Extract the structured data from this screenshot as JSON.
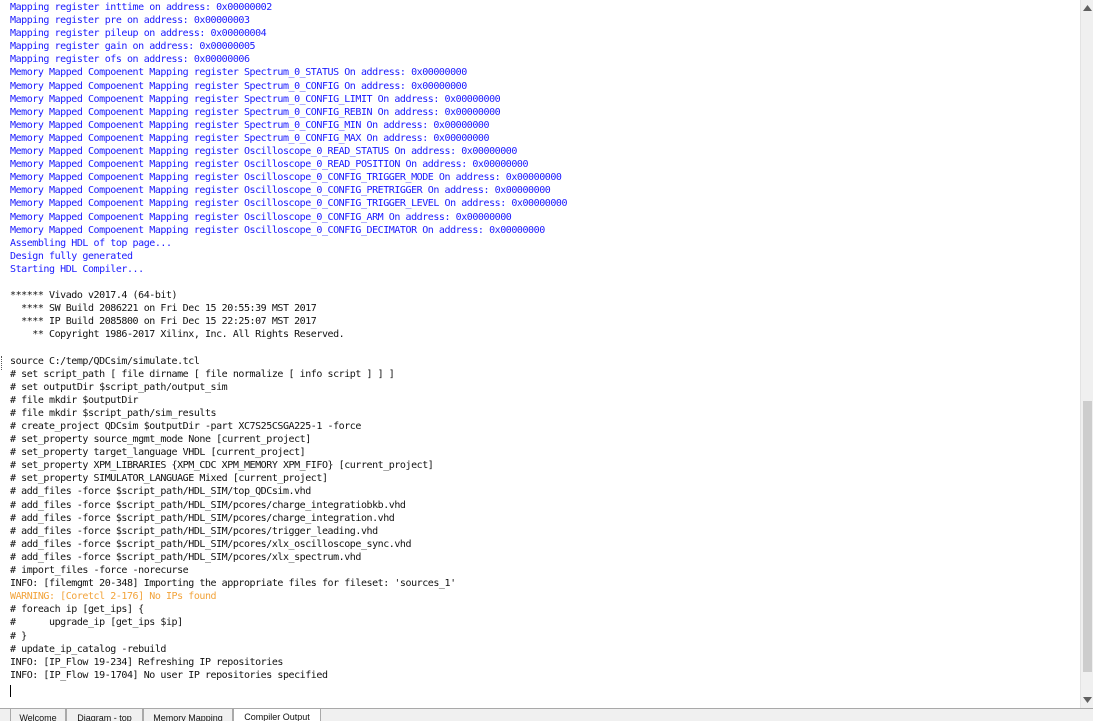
{
  "console": {
    "lines": [
      {
        "text": "Mapping register inttime on address: 0x00000002",
        "style": "blue"
      },
      {
        "text": "Mapping register pre on address: 0x00000003",
        "style": "blue"
      },
      {
        "text": "Mapping register pileup on address: 0x00000004",
        "style": "blue"
      },
      {
        "text": "Mapping register gain on address: 0x00000005",
        "style": "blue"
      },
      {
        "text": "Mapping register ofs on address: 0x00000006",
        "style": "blue"
      },
      {
        "text": "Memory Mapped Compoenent Mapping register Spectrum_0_STATUS On address: 0x00000000",
        "style": "blue"
      },
      {
        "text": "Memory Mapped Compoenent Mapping register Spectrum_0_CONFIG On address: 0x00000000",
        "style": "blue"
      },
      {
        "text": "Memory Mapped Compoenent Mapping register Spectrum_0_CONFIG_LIMIT On address: 0x00000000",
        "style": "blue"
      },
      {
        "text": "Memory Mapped Compoenent Mapping register Spectrum_0_CONFIG_REBIN On address: 0x00000000",
        "style": "blue"
      },
      {
        "text": "Memory Mapped Compoenent Mapping register Spectrum_0_CONFIG_MIN On address: 0x00000000",
        "style": "blue"
      },
      {
        "text": "Memory Mapped Compoenent Mapping register Spectrum_0_CONFIG_MAX On address: 0x00000000",
        "style": "blue"
      },
      {
        "text": "Memory Mapped Compoenent Mapping register Oscilloscope_0_READ_STATUS On address: 0x00000000",
        "style": "blue"
      },
      {
        "text": "Memory Mapped Compoenent Mapping register Oscilloscope_0_READ_POSITION On address: 0x00000000",
        "style": "blue"
      },
      {
        "text": "Memory Mapped Compoenent Mapping register Oscilloscope_0_CONFIG_TRIGGER_MODE On address: 0x00000000",
        "style": "blue"
      },
      {
        "text": "Memory Mapped Compoenent Mapping register Oscilloscope_0_CONFIG_PRETRIGGER On address: 0x00000000",
        "style": "blue"
      },
      {
        "text": "Memory Mapped Compoenent Mapping register Oscilloscope_0_CONFIG_TRIGGER_LEVEL On address: 0x00000000",
        "style": "blue"
      },
      {
        "text": "Memory Mapped Compoenent Mapping register Oscilloscope_0_CONFIG_ARM On address: 0x00000000",
        "style": "blue"
      },
      {
        "text": "Memory Mapped Compoenent Mapping register Oscilloscope_0_CONFIG_DECIMATOR On address: 0x00000000",
        "style": "blue"
      },
      {
        "text": "Assembling HDL of top page...",
        "style": "blue"
      },
      {
        "text": "Design fully generated",
        "style": "blue"
      },
      {
        "text": "Starting HDL Compiler...",
        "style": "blue"
      },
      {
        "text": "",
        "style": "black"
      },
      {
        "text": "****** Vivado v2017.4 (64-bit)",
        "style": "black"
      },
      {
        "text": "  **** SW Build 2086221 on Fri Dec 15 20:55:39 MST 2017",
        "style": "black"
      },
      {
        "text": "  **** IP Build 2085800 on Fri Dec 15 22:25:07 MST 2017",
        "style": "black"
      },
      {
        "text": "    ** Copyright 1986-2017 Xilinx, Inc. All Rights Reserved.",
        "style": "black"
      },
      {
        "text": "",
        "style": "black"
      },
      {
        "text": "source C:/temp/QDCsim/simulate.tcl",
        "style": "black"
      },
      {
        "text": "# set script_path [ file dirname [ file normalize [ info script ] ] ]",
        "style": "black"
      },
      {
        "text": "# set outputDir $script_path/output_sim",
        "style": "black"
      },
      {
        "text": "# file mkdir $outputDir",
        "style": "black"
      },
      {
        "text": "# file mkdir $script_path/sim_results",
        "style": "black"
      },
      {
        "text": "# create_project QDCsim $outputDir -part XC7S25CSGA225-1 -force",
        "style": "black"
      },
      {
        "text": "# set_property source_mgmt_mode None [current_project]",
        "style": "black"
      },
      {
        "text": "# set_property target_language VHDL [current_project]",
        "style": "black"
      },
      {
        "text": "# set_property XPM_LIBRARIES {XPM_CDC XPM_MEMORY XPM_FIFO} [current_project]",
        "style": "black"
      },
      {
        "text": "# set_property SIMULATOR_LANGUAGE Mixed [current_project]",
        "style": "black"
      },
      {
        "text": "# add_files -force $script_path/HDL_SIM/top_QDCsim.vhd",
        "style": "black"
      },
      {
        "text": "# add_files -force $script_path/HDL_SIM/pcores/charge_integratiobkb.vhd",
        "style": "black"
      },
      {
        "text": "# add_files -force $script_path/HDL_SIM/pcores/charge_integration.vhd",
        "style": "black"
      },
      {
        "text": "# add_files -force $script_path/HDL_SIM/pcores/trigger_leading.vhd",
        "style": "black"
      },
      {
        "text": "# add_files -force $script_path/HDL_SIM/pcores/xlx_oscilloscope_sync.vhd",
        "style": "black"
      },
      {
        "text": "# add_files -force $script_path/HDL_SIM/pcores/xlx_spectrum.vhd",
        "style": "black"
      },
      {
        "text": "# import_files -force -norecurse",
        "style": "black"
      },
      {
        "text": "INFO: [filemgmt 20-348] Importing the appropriate files for fileset: 'sources_1'",
        "style": "black"
      },
      {
        "text": "WARNING: [Coretcl 2-176] No IPs found",
        "style": "orange"
      },
      {
        "text": "# foreach ip [get_ips] {",
        "style": "black"
      },
      {
        "text": "#      upgrade_ip [get_ips $ip]",
        "style": "black"
      },
      {
        "text": "# }",
        "style": "black"
      },
      {
        "text": "# update_ip_catalog -rebuild",
        "style": "black"
      },
      {
        "text": "INFO: [IP_Flow 19-234] Refreshing IP repositories",
        "style": "black"
      },
      {
        "text": "INFO: [IP_Flow 19-1704] No user IP repositories specified",
        "style": "black"
      }
    ]
  },
  "scrollbar": {
    "up_icon": "triangle-up-icon",
    "down_icon": "triangle-down-icon",
    "thumb_start_fraction": 0.57,
    "thumb_size_fraction": 0.4
  },
  "tabs": [
    {
      "label": "Welcome",
      "active": false
    },
    {
      "label": "Diagram - top",
      "active": false
    },
    {
      "label": "Memory Mapping",
      "active": false
    },
    {
      "label": "Compiler Output",
      "active": true
    }
  ],
  "colors": {
    "info_text": "#1a1aff",
    "warning_text": "#f2a33a",
    "normal_text": "#111111"
  }
}
